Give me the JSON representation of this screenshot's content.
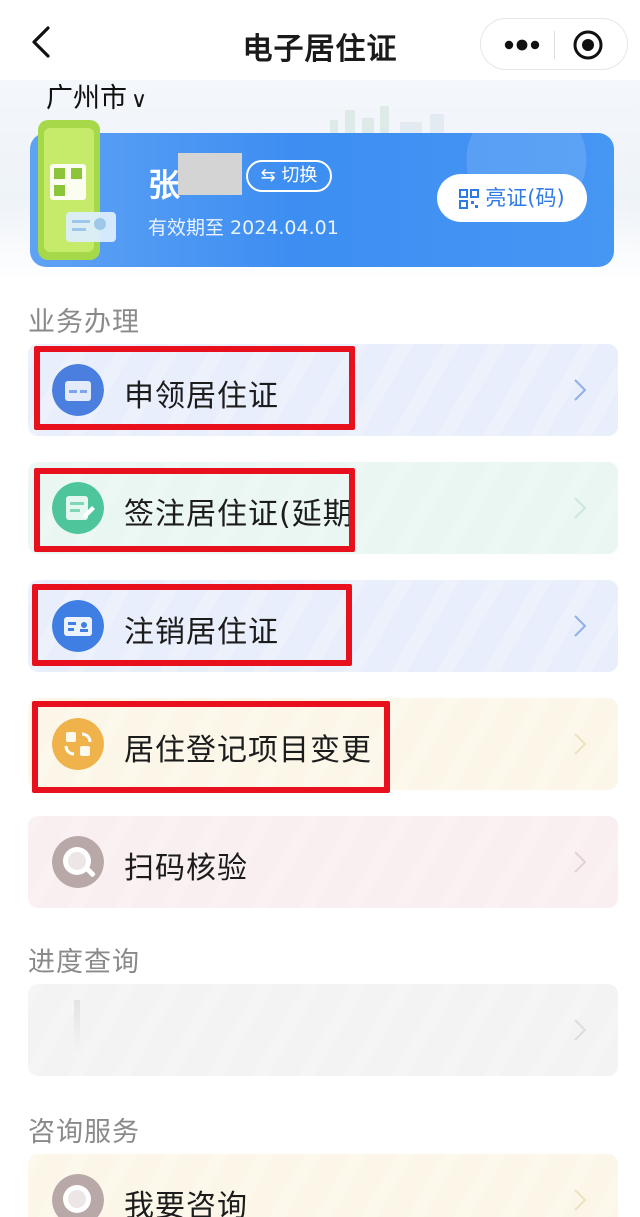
{
  "nav": {
    "title": "电子居住证",
    "back_icon": "chevron-left-icon",
    "more_icon": "more-dots-icon",
    "target_icon": "target-icon"
  },
  "hero": {
    "city": "广州市",
    "city_chevron": "∨",
    "name_initial": "张",
    "switch_label": "⇆ 切换",
    "valid_until": "有效期至 2024.04.01",
    "show_button": "亮证(码)"
  },
  "sections": {
    "business": "业务办理",
    "progress": "进度查询",
    "consult": "咨询服务"
  },
  "business_items": [
    {
      "label": "申领居住证",
      "icon": "id-card-apply-icon",
      "bg": "#e8eefb",
      "icon_color": "#4a7fe0"
    },
    {
      "label": "签注居住证(延期",
      "icon": "endorse-edit-icon",
      "bg": "#e9f6f1",
      "icon_color": "#4ec59a"
    },
    {
      "label": "注销居住证",
      "icon": "id-card-cancel-icon",
      "bg": "#e8eefb",
      "icon_color": "#3f7fe3"
    },
    {
      "label": "居住登记项目变更",
      "icon": "change-swap-icon",
      "bg": "#fbf6e8",
      "icon_color": "#f0b24a"
    },
    {
      "label": "扫码核验",
      "icon": "magnifier-scan-icon",
      "bg": "#f9eef0",
      "icon_color": "#b8a8a8"
    }
  ],
  "progress_items": [
    {
      "label": "",
      "icon": "",
      "bg": "#f3f3f3"
    }
  ],
  "consult_items": [
    {
      "label": "我要咨询",
      "icon": "magnifier-consult-icon",
      "bg": "#fbf6e8",
      "icon_color": "#b8a8a8"
    }
  ],
  "colors": {
    "highlight": "#e8101c",
    "card_blue": "#3d8ef2",
    "muted_text": "#8a8a8a"
  }
}
